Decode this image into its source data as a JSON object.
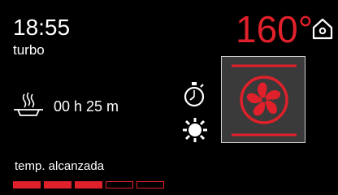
{
  "clock": {
    "time": "18:55"
  },
  "mode": {
    "label": "turbo",
    "icon": "fan-icon"
  },
  "temperature": {
    "value": "160°",
    "color": "#e0202a"
  },
  "home": {
    "icon": "home-icon"
  },
  "cooking": {
    "icon": "dish-steam-icon",
    "duration": "00 h 25 m"
  },
  "controls": {
    "timer_icon": "stopwatch-icon",
    "light_icon": "light-icon"
  },
  "status": {
    "text": "temp. alcanzada",
    "progress": {
      "segments_total": 5,
      "segments_filled": 3,
      "color": "#e0202a"
    }
  }
}
